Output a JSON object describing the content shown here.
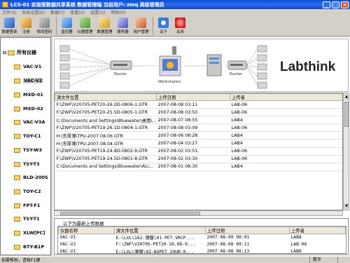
{
  "window": {
    "title": "LCS-01 实验室数据共享系统    数据管理端    当前用户: zmq 高级管理员",
    "minimize": "_",
    "maximize": "□",
    "close": "×"
  },
  "menu": [
    "文件(S)",
    "系统设置(E)",
    "数据(T)",
    "查看(V)",
    "设置(O)",
    "帮助(H)"
  ],
  "toolbar": {
    "buttons": [
      {
        "label": "数据登录",
        "icon": "login-icon"
      },
      {
        "label": "注册",
        "icon": "register-icon"
      },
      {
        "label": "修改密码",
        "icon": "password-icon"
      },
      {
        "label": "监控器",
        "icon": "monitor-icon"
      },
      {
        "label": "仪器管理",
        "icon": "device-icon"
      },
      {
        "label": "数据管理",
        "icon": "data-icon"
      },
      {
        "label": "服务器",
        "icon": "server-icon"
      },
      {
        "label": "用户管理",
        "icon": "user-icon"
      },
      {
        "label": "关于",
        "icon": "about-icon"
      },
      {
        "label": "关闭",
        "icon": "close-icon"
      }
    ]
  },
  "sidebar": {
    "root_label": "所有仪器",
    "items": [
      "VAC-V1",
      "VAC-V2",
      "MXD-01",
      "MXD-02",
      "VAC-V3A",
      "TOY-C1",
      "TSY-W3",
      "TSY-T3",
      "BLD-200S",
      "TOY-C2",
      "FPT-F1",
      "TSY-T1",
      "XLW[PC]",
      "BTY-B1P"
    ],
    "selected_index": 1
  },
  "banner": {
    "router_left": "Router",
    "workstation": "Workstation",
    "router_right": "Router",
    "brand": "Labthink"
  },
  "upload_table": {
    "columns": [
      "源文件位置",
      "上传日期",
      "上传者"
    ],
    "rows": [
      [
        "F:\\ZWF\\V20705-PET20-26.0D-0806-1.GTR",
        "2007-08-08 03:11",
        "LAB-06"
      ],
      [
        "F:\\ZWF\\V20705-PET20-25.5D-0805-1.GTR",
        "2007-08-08 03:50",
        "LAB-06"
      ],
      [
        "C:\\Documents and Settings\\Bluewater\\桌面\\...",
        "2007-08-07 08:55",
        "LAB4"
      ],
      [
        "F:\\ZWF\\V20705-PET19-26.1D-0804-1.GTR",
        "2007-08-08 03:09",
        "LAB-06"
      ],
      [
        "H:\\东厚薄\\TPU-2007.08.06.GTR",
        "2007-08-06 08:28",
        "LAB4"
      ],
      [
        "H:\\东厚薄\\TPU-2007.08.04.GTR",
        "2007-08-04 03:27",
        "LAB4"
      ],
      [
        "F:\\ZWF\\V20705-PET19-24.8D-0802-9.GTR",
        "2007-08-02 03:51",
        "LAB-06"
      ],
      [
        "F:\\ZWF\\V20705-PET19-24.5D-0801-8.GTR",
        "2007-08-02 03:30",
        "LAB-06"
      ],
      [
        "C:\\Documents and Settings\\Bluewater\\AL\\...",
        "2007-08-01 08:30",
        "LAB4"
      ]
    ]
  },
  "recent_panel": {
    "title": "以下为最新上传数据",
    "columns": [
      "仪器名称",
      "源文件位置",
      "上传日期",
      "上传者"
    ],
    "rows": [
      [
        "VAC-V1",
        "E:\\LXL\\162-薄膜\\01-PET.VRCP...",
        "2007-08-09 08:01",
        "LAB8"
      ],
      [
        "VAC-V2",
        "F:\\ZWF\\V20705-PET20-26.0D-0...",
        "2007-08-08 09:11",
        "LAB-06"
      ],
      [
        "VAC-V1",
        "E:\\LXL\\薄膜\\02-BOPET 20UM-0...",
        "2007-08-08 08:13",
        "LAB8"
      ]
    ]
  },
  "status": {
    "left": "如需帮助，请按F1键",
    "mid": "数字"
  }
}
